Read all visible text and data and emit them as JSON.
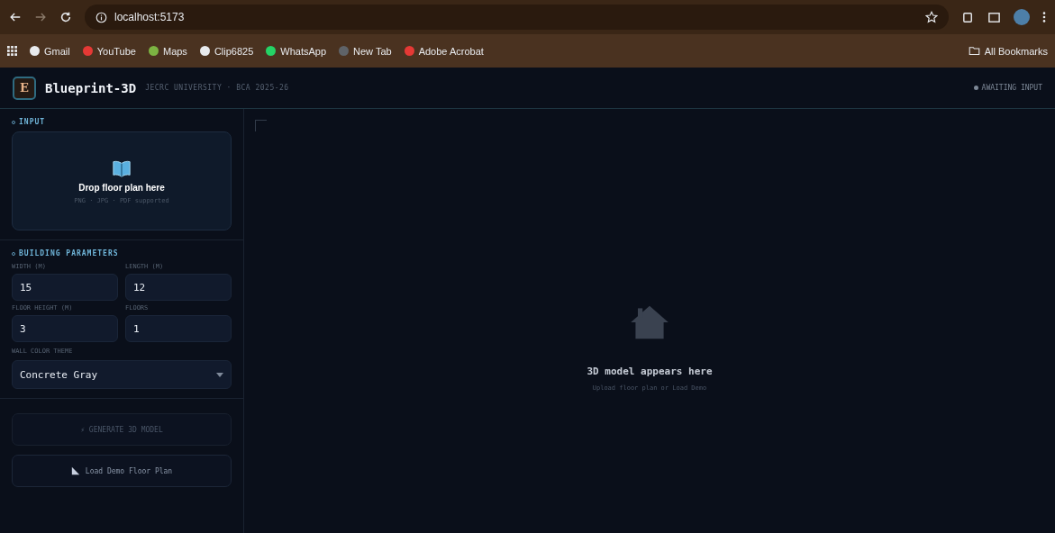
{
  "browser": {
    "url": "localhost:5173",
    "bookmarks": [
      {
        "label": "Gmail",
        "color": "#e8eaed"
      },
      {
        "label": "YouTube",
        "color": "#e53935"
      },
      {
        "label": "Maps",
        "color": "#7cb342"
      },
      {
        "label": "Clip6825",
        "color": "#e8eaed"
      },
      {
        "label": "WhatsApp",
        "color": "#25d366"
      },
      {
        "label": "New Tab",
        "color": "#5f6368"
      },
      {
        "label": "Adobe Acrobat",
        "color": "#e53935"
      }
    ],
    "all_bookmarks": "All Bookmarks"
  },
  "header": {
    "logo_letter": "E",
    "title": "Blueprint-3D",
    "subtitle": "JECRC UNIVERSITY · BCA 2025-26",
    "status": "AWAITING INPUT"
  },
  "sidebar": {
    "input_heading": "INPUT",
    "dropzone": {
      "title": "Drop floor plan here",
      "hint": "PNG · JPG · PDF supported"
    },
    "params_heading": "BUILDING PARAMETERS",
    "fields": [
      {
        "label": "WIDTH (M)",
        "value": "15"
      },
      {
        "label": "LENGTH (M)",
        "value": "12"
      },
      {
        "label": "FLOOR HEIGHT (M)",
        "value": "3"
      },
      {
        "label": "FLOORS",
        "value": "1"
      }
    ],
    "select": {
      "label": "WALL COLOR THEME",
      "value": "Concrete Gray"
    },
    "generate_button": {
      "label": "⚡ GENERATE 3D MODEL",
      "disabled": true
    },
    "demo_button": {
      "label": "Load Demo Floor Plan"
    }
  },
  "viewport": {
    "title": "3D model appears here",
    "hint": "Upload floor plan or Load Demo"
  }
}
